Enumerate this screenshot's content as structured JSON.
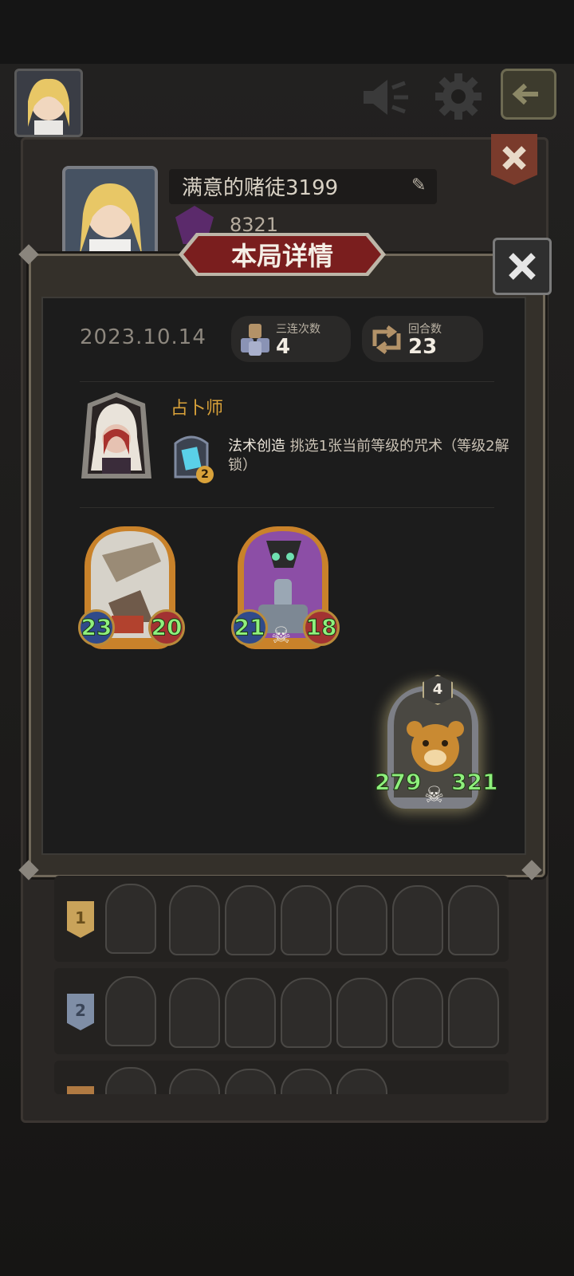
{
  "player": {
    "name": "满意的赌徒3199",
    "rank_score": "8321"
  },
  "dialog": {
    "title": "本局详情",
    "date": "2023.10.14",
    "stats": [
      {
        "label": "三连次数",
        "value": "4"
      },
      {
        "label": "回合数",
        "value": "23"
      }
    ],
    "hero": {
      "name": "占卜师",
      "power_level": "2",
      "power_name": "法术创造",
      "power_desc": " 挑选1张当前等级的咒术（等级2解锁）"
    },
    "minions": [
      {
        "attack": "23",
        "health": "20",
        "golden": true
      },
      {
        "attack": "21",
        "health": "18",
        "golden": true
      },
      {
        "attack": "279",
        "health": "321",
        "tier": "4",
        "golden": false
      }
    ]
  },
  "leaderboard": [
    {
      "place": "1"
    },
    {
      "place": "2"
    },
    {
      "place": ""
    }
  ],
  "colors": {
    "gold": "#d9a23a",
    "stat_green": "#8ff07d",
    "banner_red": "#7a1e1e"
  }
}
